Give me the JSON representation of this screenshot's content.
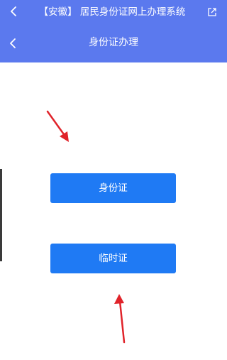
{
  "top_bar": {
    "title": "【安徽】 居民身份证网上办理系统",
    "back_icon": "chevron-left-icon",
    "share_icon": "share-icon"
  },
  "nav_bar": {
    "title": "身份证办理",
    "back_icon": "chevron-left-icon"
  },
  "actions": {
    "id_card_label": "身份证",
    "temp_card_label": "临时证"
  },
  "colors": {
    "header_bg": "#5b79ee",
    "button_bg": "#1f7af4",
    "arrow": "#e0232a"
  }
}
